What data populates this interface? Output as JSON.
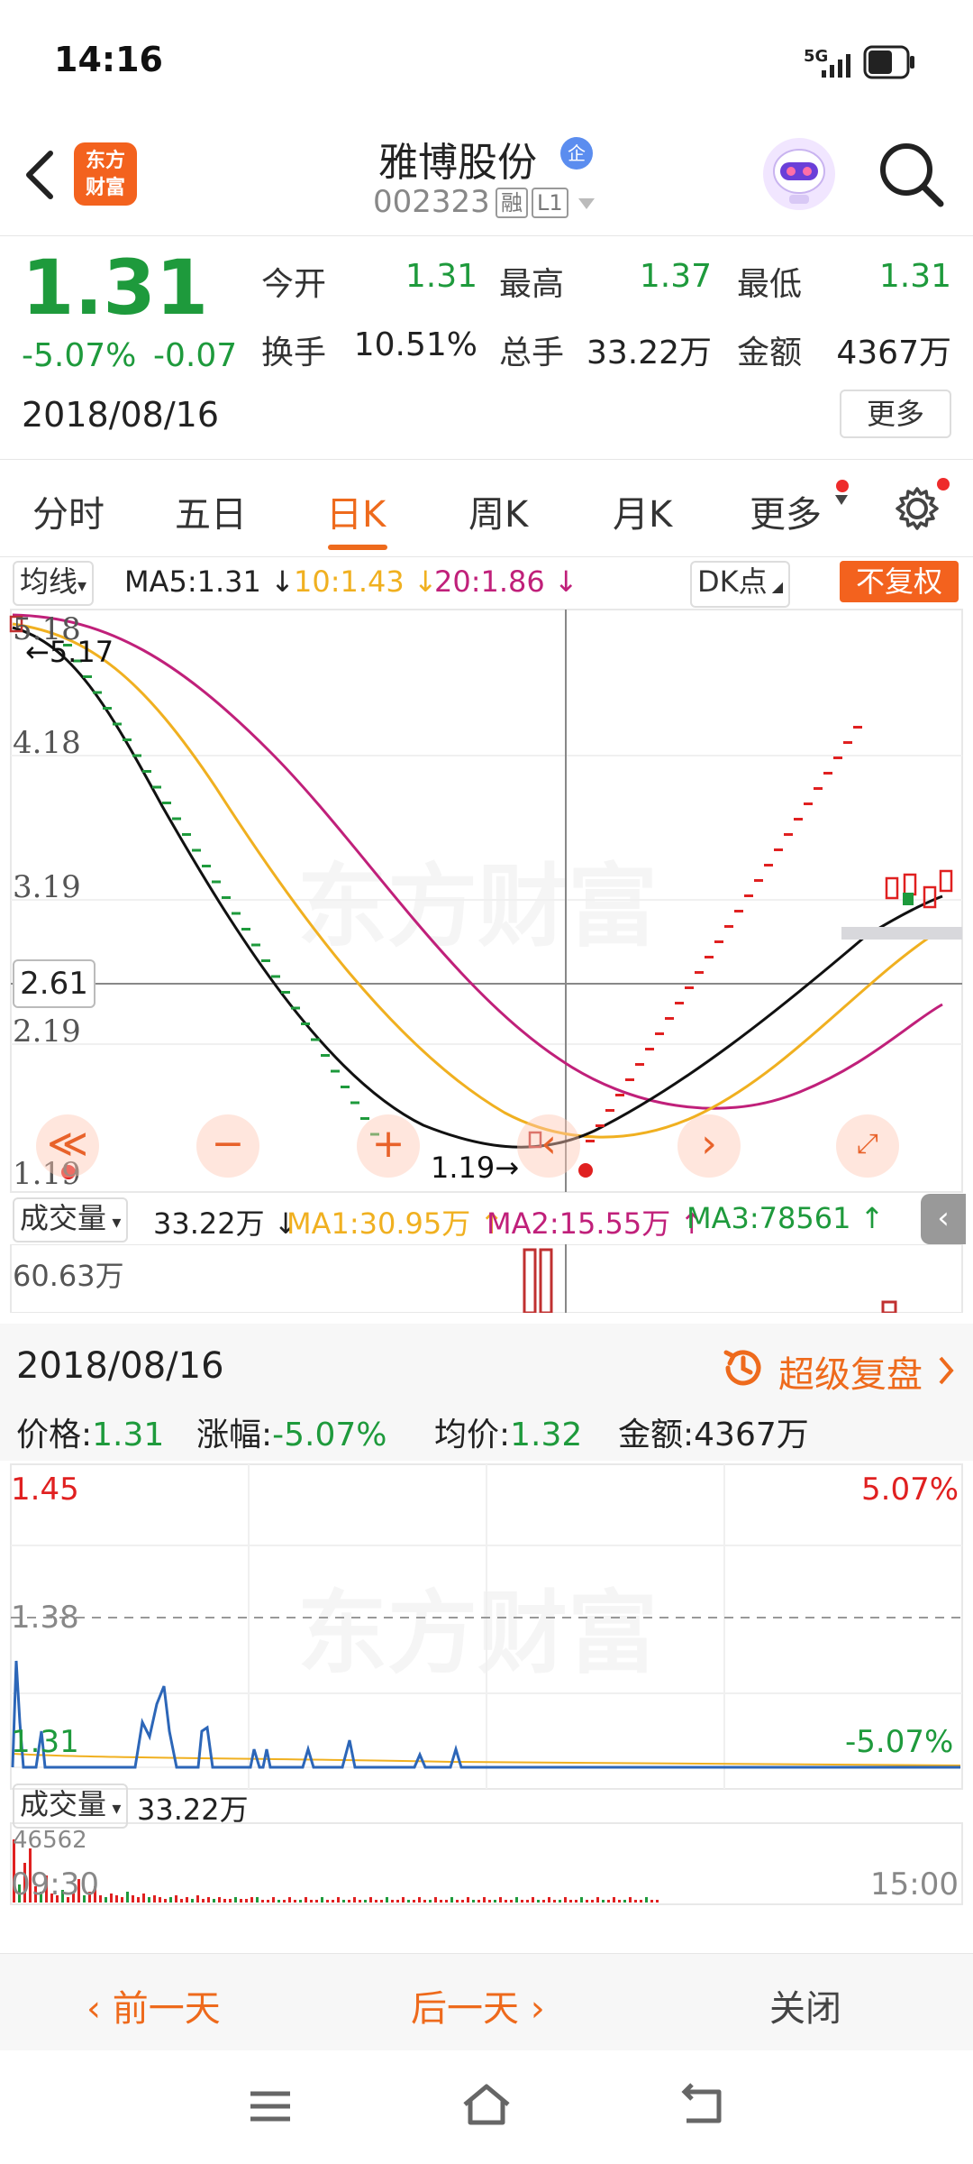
{
  "status": {
    "time": "14:16",
    "network": "5G"
  },
  "header": {
    "logo_line1": "东方",
    "logo_line2": "财富",
    "stock_name": "雅博股份",
    "stock_badge": "企",
    "stock_code": "002323",
    "tag1": "融",
    "tag2": "L1"
  },
  "quote": {
    "price": "1.31",
    "change_pct": "-5.07%",
    "change_amt": "-0.07",
    "date": "2018/08/16",
    "open_label": "今开",
    "open": "1.31",
    "high_label": "最高",
    "high": "1.37",
    "low_label": "最低",
    "low": "1.31",
    "turnover_label": "换手",
    "turnover": "10.51%",
    "volume_label": "总手",
    "volume": "33.22万",
    "amount_label": "金额",
    "amount": "4367万",
    "more": "更多"
  },
  "tabs": [
    {
      "label": "分时"
    },
    {
      "label": "五日"
    },
    {
      "label": "日K"
    },
    {
      "label": "周K"
    },
    {
      "label": "月K"
    },
    {
      "label": "更多"
    }
  ],
  "ma": {
    "selector": "均线",
    "ma5": "MA5:1.31 ↓",
    "ma10": "10:1.43 ↓",
    "ma20": "20:1.86 ↓",
    "dk": "DK点",
    "restore": "不复权"
  },
  "kchart": {
    "y_labels": [
      "5.18",
      "4.18",
      "3.19",
      "2.19",
      "1.19"
    ],
    "top_annotation": "←5.17",
    "low_annotation": "1.19→",
    "crosshair_price": "2.61",
    "watermark": "东方财富"
  },
  "volume": {
    "selector": "成交量",
    "value": "33.22万 ↓",
    "ma1": "MA1:30.95万 ↑",
    "ma2": "MA2:15.55万 ↑",
    "ma3": "MA3:78561 ↑",
    "max_label": "60.63万"
  },
  "replay": {
    "date": "2018/08/16",
    "super_replay": "超级复盘",
    "price_label": "价格:",
    "price": "1.31",
    "change_label": "涨幅:",
    "change": "-5.07%",
    "avg_label": "均价:",
    "avg": "1.32",
    "amount_label": "金额:",
    "amount": "4367万"
  },
  "intraday": {
    "top_price": "1.45",
    "mid_price": "1.38",
    "bottom_price": "1.31",
    "top_pct": "5.07%",
    "bottom_pct": "-5.07%",
    "vol_selector": "成交量",
    "vol_value": "33.22万",
    "vol_max": "46562",
    "time_start": "09:30",
    "time_end": "15:00"
  },
  "bottom": {
    "prev": "前一天",
    "next": "后一天",
    "close": "关闭"
  },
  "colors": {
    "accent": "#ee6a1c",
    "down_green": "#1e9a3c",
    "up_red": "#e02020",
    "ma5": "#111111",
    "ma10": "#f0b020",
    "ma20": "#c0207a"
  }
}
